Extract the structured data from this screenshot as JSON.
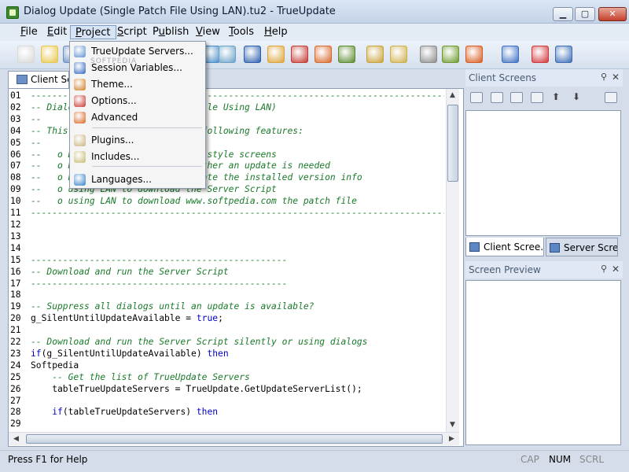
{
  "window": {
    "title": "Dialog Update (Single Patch File Using LAN).tu2 - TrueUpdate",
    "minimize": "▁",
    "maximize": "▢",
    "close": "✕"
  },
  "menu": {
    "items": [
      {
        "label": "File",
        "key": "F"
      },
      {
        "label": "Edit",
        "key": "E"
      },
      {
        "label": "Project",
        "key": "P"
      },
      {
        "label": "Script",
        "key": "S"
      },
      {
        "label": "Publish",
        "key": "u"
      },
      {
        "label": "View",
        "key": "V"
      },
      {
        "label": "Tools",
        "key": "T"
      },
      {
        "label": "Help",
        "key": "H"
      }
    ]
  },
  "project_menu": {
    "items": [
      {
        "label": "TrueUpdate Servers...",
        "icon": "servers-icon",
        "color": "#5b8fd0"
      },
      {
        "label": "Session Variables...",
        "icon": "session-variables-icon",
        "color": "#2a63c0"
      },
      {
        "label": "Theme...",
        "icon": "theme-icon",
        "color": "#d07a20"
      },
      {
        "label": "Options...",
        "icon": "options-icon",
        "color": "#c8302a"
      },
      {
        "label": "Advanced",
        "icon": "advanced-icon",
        "color": "#d8621a"
      },
      {
        "label": "Plugins...",
        "icon": "plugins-icon",
        "color": "#c9b07a"
      },
      {
        "label": "Includes...",
        "icon": "includes-icon",
        "color": "#c2b96a"
      },
      {
        "label": "Languages...",
        "icon": "languages-icon",
        "color": "#2f7fc8"
      }
    ]
  },
  "toolbar": {
    "colors": [
      "#d9d9d9",
      "#e7c64a",
      "#6c8fc0",
      "#4a8ec9",
      "#6aa1c8",
      "#2c5fad",
      "#dca438",
      "#c43b34",
      "#d8692e",
      "#5a8b2c",
      "#c9a13a",
      "#cfb04d",
      "#8b8b8b",
      "#6c9a2d",
      "#d75b1f",
      "#3c6fc1",
      "#d0353a",
      "#3b6cb5"
    ]
  },
  "document": {
    "tab_label": "Client Screens"
  },
  "code_lines": [
    {
      "n": "01",
      "t": "---------------------------------------------------------------------------------",
      "cls": "c"
    },
    {
      "n": "02",
      "t": "-- Dialog Update (Single Patch File Using LAN)",
      "cls": "c"
    },
    {
      "n": "03",
      "t": "--",
      "cls": "c"
    },
    {
      "n": "04",
      "t": "-- This script demonstrates the following features:",
      "cls": "c"
    },
    {
      "n": "05",
      "t": "--",
      "cls": "c"
    },
    {
      "n": "06",
      "t": "--   o Dialog update with wizard style screens",
      "cls": "c"
    },
    {
      "n": "07",
      "t": "--   o Notify user and check whether an update is needed",
      "cls": "c"
    },
    {
      "n": "08",
      "t": "--   o Registry detection to locate the installed version info",
      "cls": "c"
    },
    {
      "n": "09",
      "t": "--   o using LAN to download the Server Script",
      "cls": "c"
    },
    {
      "n": "10",
      "t": "--   o using LAN to download www.softpedia.com the patch file",
      "cls": "c"
    },
    {
      "n": "11",
      "t": "---------------------------------------------------------------------------------",
      "cls": "c"
    },
    {
      "n": "12",
      "t": "",
      "cls": ""
    },
    {
      "n": "13",
      "t": "",
      "cls": ""
    },
    {
      "n": "14",
      "t": "",
      "cls": ""
    },
    {
      "n": "15",
      "t": "------------------------------------------------",
      "cls": "c"
    },
    {
      "n": "16",
      "t": "-- Download and run the Server Script",
      "cls": "c"
    },
    {
      "n": "17",
      "t": "------------------------------------------------",
      "cls": "c"
    },
    {
      "n": "18",
      "t": "",
      "cls": ""
    },
    {
      "n": "19",
      "t": "-- Suppress all dialogs until an update is available?",
      "cls": "c"
    },
    {
      "n": "20",
      "t": "g_SilentUntilUpdateAvailable = @true@;",
      "cls": ""
    },
    {
      "n": "21",
      "t": "",
      "cls": ""
    },
    {
      "n": "22",
      "t": "-- Download and run the Server Script silently or using dialogs",
      "cls": "c"
    },
    {
      "n": "23",
      "t": "@if@(g_SilentUntilUpdateAvailable) @then@",
      "cls": ""
    },
    {
      "n": "24",
      "t": "Softpedia",
      "cls": ""
    },
    {
      "n": "25",
      "t": "    -- Get the list of TrueUpdate Servers",
      "cls": "c"
    },
    {
      "n": "26",
      "t": "    tableTrueUpdateServers = TrueUpdate.GetUpdateServerList();",
      "cls": ""
    },
    {
      "n": "27",
      "t": "",
      "cls": ""
    },
    {
      "n": "28",
      "t": "    @if@(tableTrueUpdateServers) @then@",
      "cls": ""
    },
    {
      "n": "29",
      "t": "",
      "cls": ""
    }
  ],
  "panels": {
    "client_screens": {
      "title": "Client Screens",
      "pin": "⚲",
      "close": "✕"
    },
    "tabs": [
      {
        "label": "Client Scree..."
      },
      {
        "label": "Server Scre..."
      }
    ],
    "screen_preview": {
      "title": "Screen Preview",
      "pin": "⚲",
      "close": "✕"
    }
  },
  "status": {
    "help_text": "Press F1 for Help",
    "caps": "CAP",
    "num": "NUM",
    "scroll": "SCRL"
  },
  "watermark": "SOFTPEDIA",
  "colors": {
    "comment": "#1a7a2a",
    "keyword": "#0000c8"
  }
}
